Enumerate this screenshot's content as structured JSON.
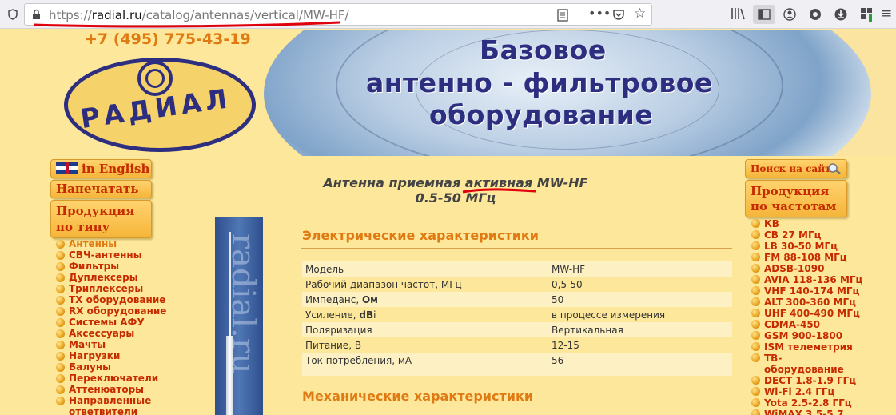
{
  "browser": {
    "url_scheme": "https://",
    "url_host": "radial.ru",
    "url_path": "/catalog/antennas/vertical/MW-HF/",
    "icons": [
      "shield-icon",
      "lock-icon",
      "reader-view-icon",
      "more-icon",
      "pocket-icon",
      "bookmark-star-icon",
      "library-icon",
      "sidebar-icon",
      "account-icon",
      "extension-icon",
      "download-icon",
      "apps-icon",
      "menu-icon"
    ]
  },
  "header": {
    "phone": "+7 (495) 775-43-19",
    "logo_text": "РАДИАЛ",
    "slogan_line1": "Базовое",
    "slogan_line2": "антенно - фильтровое",
    "slogan_line3": "оборудование"
  },
  "left_nav": {
    "english_label": "in English",
    "print_label": "Напечатать",
    "products_by_type_line1": "Продукция",
    "products_by_type_line2": "по типу",
    "items": [
      "Антенны",
      "СВЧ-антенны",
      "Фильтры",
      "Дуплексеры",
      "Триплексеры",
      "ТХ оборудование",
      "RX оборудование",
      "Системы АФУ",
      "Аксессуары",
      "Мачты",
      "Нагрузки",
      "Балуны",
      "Переключатели",
      "Аттенюаторы",
      "Направленные",
      "ответвители"
    ]
  },
  "right_nav": {
    "search_label": "Поиск на сайте",
    "products_by_freq_line1": "Продукция",
    "products_by_freq_line2": "по частотам",
    "items": [
      "КВ",
      "CB 27 МГц",
      "LB 30-50 МГц",
      "FM 88-108 МГц",
      "ADSB-1090",
      "AVIA 118-136 МГц",
      "VHF 140-174 МГц",
      "ALT 300-360 МГц",
      "UHF 400-490 МГц",
      "CDMA-450",
      "GSM 900-1800",
      "ISM телеметрия",
      "ТВ-",
      "оборудование",
      "DECT 1.8-1.9 ГГц",
      "Wi-Fi 2.4 ГГц",
      "Yota 2.5-2.8 ГГц",
      "WiMAX 3.5-5.7"
    ]
  },
  "product": {
    "watermark": "radial.ru",
    "title_part1": "Антенна приемная ",
    "title_part2": "активная",
    "title_part3": " MW-HF",
    "title_line2": "0.5-50 МГц"
  },
  "electrical": {
    "heading": "Электрические характеристики",
    "rows": [
      {
        "label": "Модель",
        "value": "MW-HF"
      },
      {
        "label": "Рабочий диапазон частот, МГц",
        "value": "0,5-50"
      },
      {
        "label_pre": "Импеданс, ",
        "label_bold": "Ом",
        "value": "50"
      },
      {
        "label_pre": "Усиление, ",
        "label_bold": "dB",
        "label_post": "i",
        "value": "в процессе измерения"
      },
      {
        "label": "Поляризация",
        "value": "Вертикальная"
      },
      {
        "label": "Питание, В",
        "value": "12-15"
      },
      {
        "label": "Ток потребления, мА",
        "value": "56"
      }
    ]
  },
  "mechanical": {
    "heading": "Механические характеристики"
  },
  "annotation_color": "#e0000b"
}
